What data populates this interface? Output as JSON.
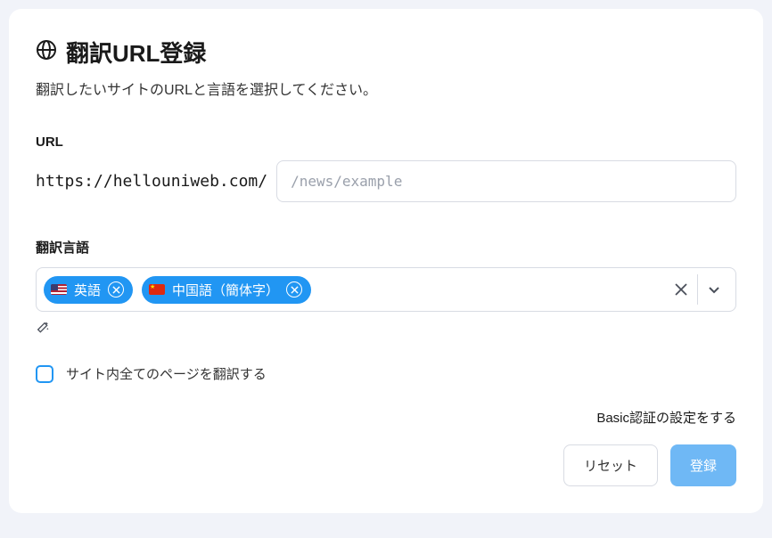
{
  "header": {
    "title": "翻訳URL登録",
    "subtitle": "翻訳したいサイトのURLと言語を選択してください。"
  },
  "url": {
    "label": "URL",
    "base": "https://hellouniweb.com/",
    "placeholder": "/news/example",
    "value": ""
  },
  "languages": {
    "label": "翻訳言語",
    "selected": [
      {
        "code": "en",
        "label": "英語",
        "flag": "us"
      },
      {
        "code": "zh-CN",
        "label": "中国語（簡体字）",
        "flag": "cn"
      }
    ]
  },
  "translateAll": {
    "checked": false,
    "label": "サイト内全てのページを翻訳する"
  },
  "basicAuthLink": "Basic認証の設定をする",
  "buttons": {
    "reset": "リセット",
    "submit": "登録"
  }
}
